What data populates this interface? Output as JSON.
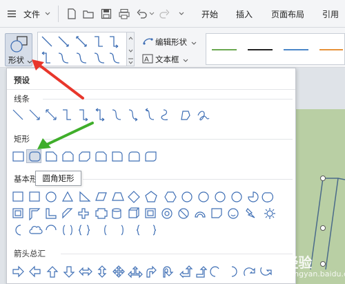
{
  "toolbar": {
    "file_label": "文件",
    "menu_tabs": [
      "开始",
      "插入",
      "页面布局",
      "引用"
    ]
  },
  "ribbon": {
    "shapes_button_label": "形状",
    "edit_shape_label": "编辑形状",
    "text_box_label": "文本框"
  },
  "dropdown": {
    "header": "预设",
    "sections": {
      "lines": "线条",
      "rectangles": "矩形",
      "basic": "基本形",
      "arrows": "箭头总汇"
    }
  },
  "tooltip": {
    "text": "圆角矩形"
  },
  "watermark": {
    "text": "Bai 经验",
    "sub": "jingyan.baidu.com"
  },
  "colors": {
    "icon_stroke": "#3f6fb5",
    "arrow_red": "#e8362b",
    "arrow_green": "#3fae2a",
    "doc_green": "#b9cfa4",
    "line_green": "#6aa84f",
    "line_orange": "#e69138",
    "line_blue": "#4a86c8"
  }
}
